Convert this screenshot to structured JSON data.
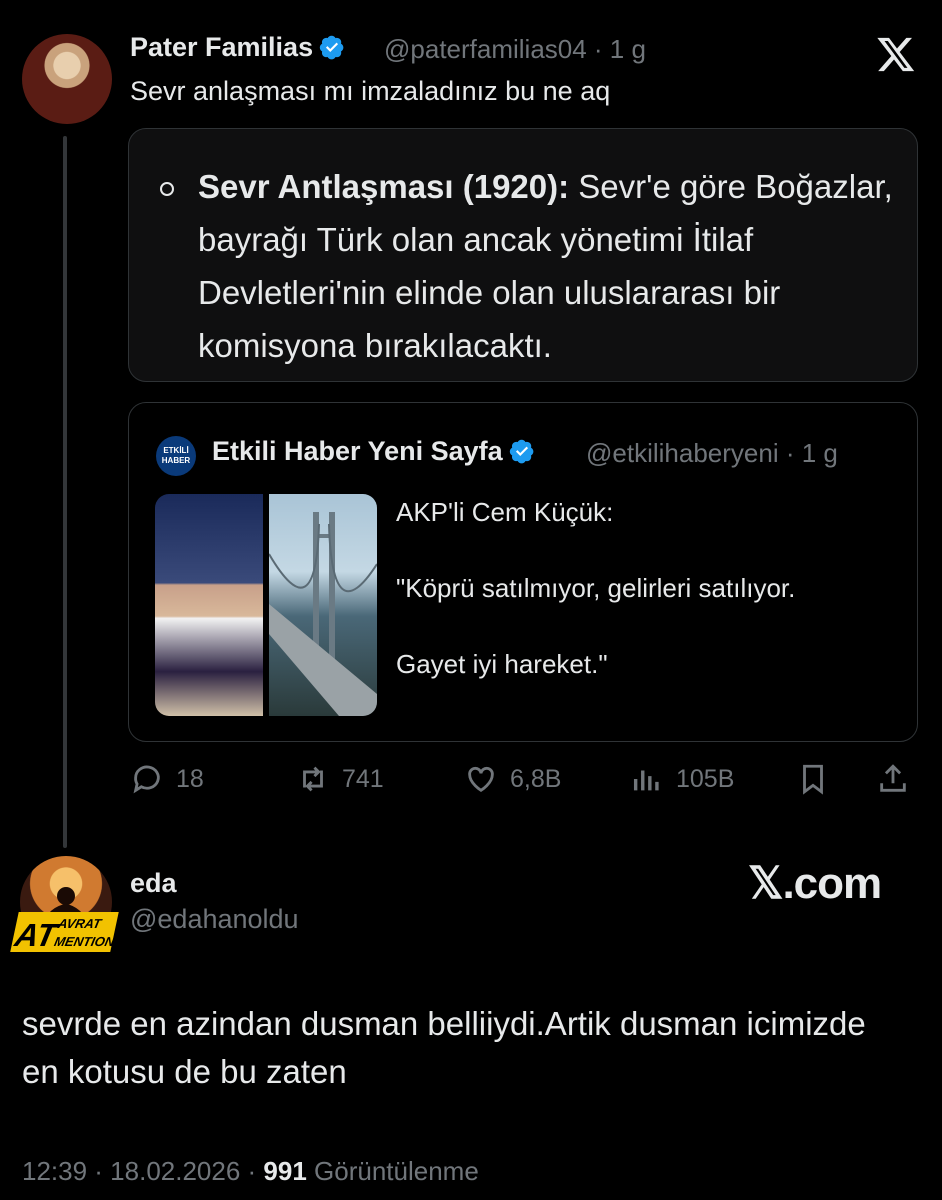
{
  "colors": {
    "background": "#000000",
    "text": "#e7e9ea",
    "muted": "#71767b",
    "border": "#2f3336",
    "verified": "#1d9bf0"
  },
  "tweet": {
    "author_name": "Pater Familias",
    "handle_time": "@paterfamilias04 · 1 g",
    "text": "Sevr anlaşması mı imzaladınız bu ne aq",
    "screenshot_card": {
      "bold_lead": "Sevr Antlaşması (1920):",
      "body": " Sevr'e göre Boğazlar, bayrağı Türk olan ancak yönetimi İtilaf Devletleri'nin elinde olan uluslararası bir komisyona bırakılacaktı."
    },
    "quoted": {
      "avatar_text": "ETKİLİ HABER",
      "author_name": "Etkili Haber Yeni Sayfa",
      "handle_time": "@etkilihaberyeni · 1 g",
      "lines": [
        "AKP'li Cem Küçük:",
        "\"Köprü satılmıyor, gelirleri satılıyor.",
        "Gayet iyi hareket.\""
      ]
    },
    "actions": {
      "replies": "18",
      "retweets": "741",
      "likes": "6,8B",
      "views": "105B"
    }
  },
  "reply": {
    "author_name": "eda",
    "handle": "@edahanoldu",
    "badge_text": [
      "AT",
      "AVRAT",
      "MENTION"
    ],
    "watermark": "𝕏.com",
    "text": "sevrde en azindan dusman belliiydi.Artik dusman icimizde en kotusu de bu zaten",
    "time_date": "12:39 · 18.02.2026 · ",
    "views_count": "991",
    "views_label": " Görüntülenme"
  },
  "icons": [
    "verified-icon",
    "x-logo-icon",
    "reply-icon",
    "retweet-icon",
    "like-icon",
    "views-icon",
    "bookmark-icon",
    "share-icon"
  ]
}
